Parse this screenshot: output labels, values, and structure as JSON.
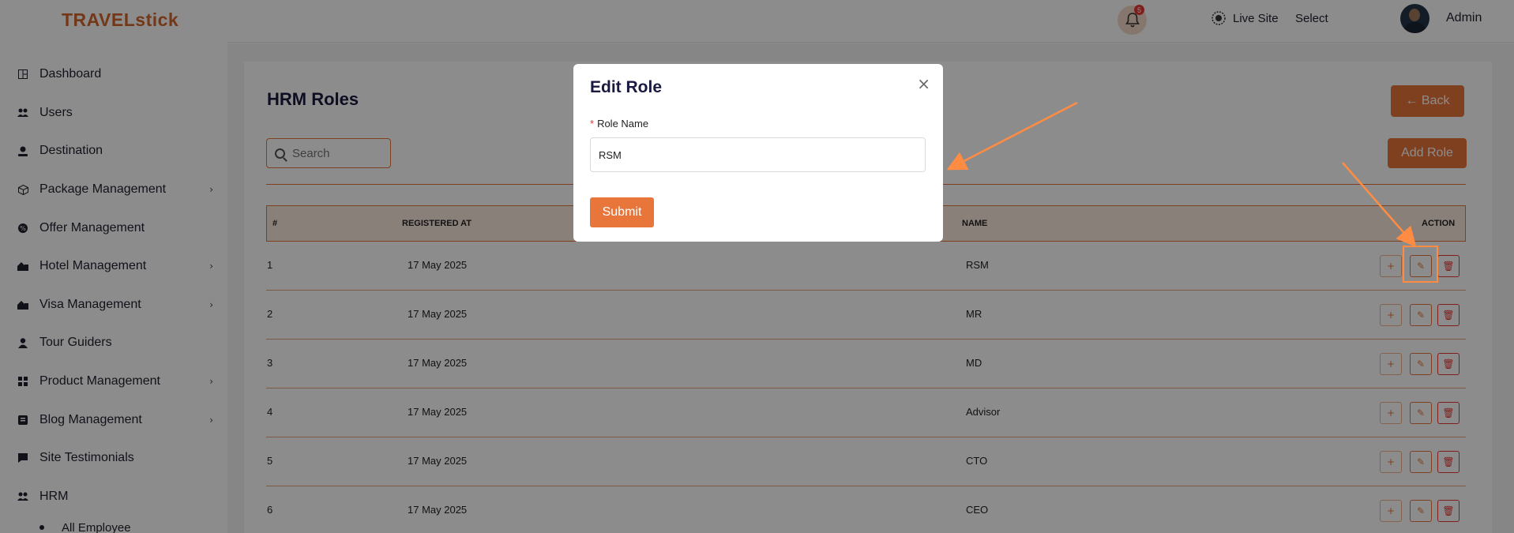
{
  "brand": {
    "logo_text": "TRAVELstick"
  },
  "sidebar": {
    "items": [
      {
        "label": "Dashboard",
        "icon": "dashboard-icon",
        "chevron": false
      },
      {
        "label": "Users",
        "icon": "users-icon",
        "chevron": false
      },
      {
        "label": "Destination",
        "icon": "location-icon",
        "chevron": false
      },
      {
        "label": "Package Management",
        "icon": "package-icon",
        "chevron": true
      },
      {
        "label": "Offer Management",
        "icon": "offer-icon",
        "chevron": false
      },
      {
        "label": "Hotel Management",
        "icon": "hotel-icon",
        "chevron": true
      },
      {
        "label": "Visa Management",
        "icon": "visa-icon",
        "chevron": true
      },
      {
        "label": "Tour Guiders",
        "icon": "guide-icon",
        "chevron": false
      },
      {
        "label": "Product Management",
        "icon": "grid-icon",
        "chevron": true
      },
      {
        "label": "Blog Management",
        "icon": "blog-icon",
        "chevron": true
      },
      {
        "label": "Site Testimonials",
        "icon": "comment-icon",
        "chevron": false
      },
      {
        "label": "HRM",
        "icon": "team-icon",
        "chevron": false
      }
    ],
    "sub_item": "All Employee"
  },
  "topbar": {
    "live_site": "Live Site",
    "select": "Select",
    "notification_count": "5",
    "admin_name": "Admin"
  },
  "page": {
    "title": "HRM Roles",
    "back_label": "← Back",
    "search_placeholder": "Search",
    "add_role_label": "Add Role"
  },
  "table": {
    "headers": {
      "num": "#",
      "registered": "REGISTERED AT",
      "name": "NAME",
      "action": "ACTION"
    },
    "rows": [
      {
        "num": "1",
        "registered": "17 May 2025",
        "name": "RSM"
      },
      {
        "num": "2",
        "registered": "17 May 2025",
        "name": "MR"
      },
      {
        "num": "3",
        "registered": "17 May 2025",
        "name": "MD"
      },
      {
        "num": "4",
        "registered": "17 May 2025",
        "name": "Advisor"
      },
      {
        "num": "5",
        "registered": "17 May 2025",
        "name": "CTO"
      },
      {
        "num": "6",
        "registered": "17 May 2025",
        "name": "CEO"
      }
    ]
  },
  "modal": {
    "title": "Edit Role",
    "field_label": "Role Name",
    "required_mark": "*",
    "field_value": "RSM",
    "submit_label": "Submit",
    "close_glyph": "×"
  },
  "colors": {
    "accent": "#e8763a",
    "danger": "#e53935",
    "title": "#1a1a40"
  }
}
